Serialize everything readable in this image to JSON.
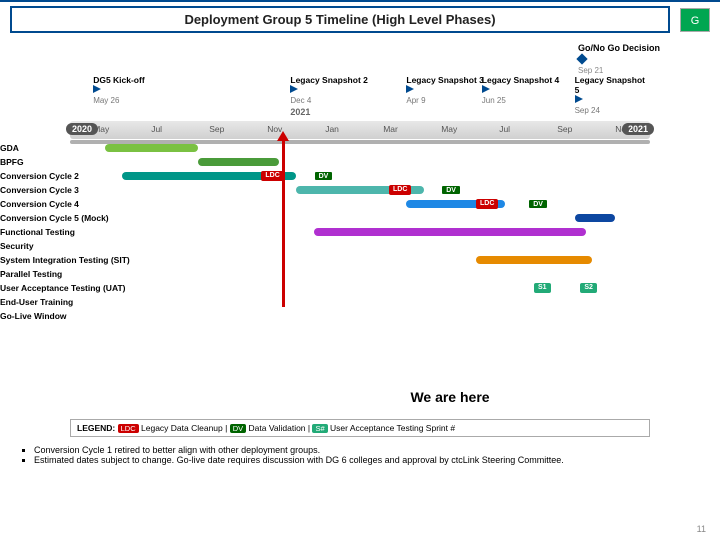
{
  "header": {
    "title": "Deployment Group 5 Timeline (High Level Phases)",
    "status": "G"
  },
  "gonogo": {
    "label": "Go/No Go Decision",
    "date": "Sep 21"
  },
  "milestones": [
    {
      "label": "DG5 Kick-off",
      "date": "May 26",
      "x": 4
    },
    {
      "label": "Legacy Snapshot 2",
      "date": "Dec 4",
      "x": 38
    },
    {
      "label": "Legacy Snapshot 3",
      "date": "Apr 9",
      "x": 58
    },
    {
      "label": "Legacy Snapshot 4",
      "date": "Jun 25",
      "x": 71
    },
    {
      "label": "Legacy Snapshot 5",
      "date": "Sep 24",
      "x": 87
    }
  ],
  "axis": {
    "yearLeft": "2020",
    "yearRight": "2021",
    "midYear": "2021",
    "ticks": [
      {
        "t": "May",
        "x": 4
      },
      {
        "t": "Jul",
        "x": 14
      },
      {
        "t": "Sep",
        "x": 24
      },
      {
        "t": "Nov",
        "x": 34
      },
      {
        "t": "Jan",
        "x": 44
      },
      {
        "t": "Mar",
        "x": 54
      },
      {
        "t": "May",
        "x": 64
      },
      {
        "t": "Jul",
        "x": 74
      },
      {
        "t": "Sep",
        "x": 84
      },
      {
        "t": "Nov",
        "x": 94
      }
    ]
  },
  "rows": [
    {
      "name": "GDA",
      "bars": [
        {
          "x": 6,
          "w": 16,
          "c": "c-green1"
        }
      ]
    },
    {
      "name": "BPFG",
      "bars": [
        {
          "x": 22,
          "w": 14,
          "c": "c-green2"
        }
      ]
    },
    {
      "name": "Conversion Cycle 2",
      "bars": [
        {
          "x": 9,
          "w": 30,
          "c": "c-teal"
        }
      ],
      "markers": [
        {
          "t": "LDC",
          "x": 33,
          "c": "ldc"
        },
        {
          "t": "DV",
          "x": 42,
          "c": "dv"
        }
      ]
    },
    {
      "name": "Conversion Cycle 3",
      "bars": [
        {
          "x": 39,
          "w": 22,
          "c": "c-teal-l"
        }
      ],
      "markers": [
        {
          "t": "LDC",
          "x": 55,
          "c": "ldc"
        },
        {
          "t": "DV",
          "x": 64,
          "c": "dv"
        }
      ]
    },
    {
      "name": "Conversion Cycle 4",
      "bars": [
        {
          "x": 58,
          "w": 17,
          "c": "c-blue3"
        }
      ],
      "markers": [
        {
          "t": "LDC",
          "x": 70,
          "c": "ldc"
        },
        {
          "t": "DV",
          "x": 79,
          "c": "dv"
        }
      ]
    },
    {
      "name": "Conversion Cycle 5 (Mock)",
      "bars": [
        {
          "x": 87,
          "w": 7,
          "c": "c-blue4"
        }
      ]
    },
    {
      "name": "Functional Testing",
      "bars": [
        {
          "x": 42,
          "w": 47,
          "c": "c-purple"
        }
      ]
    },
    {
      "name": "Security",
      "bars": []
    },
    {
      "name": "System Integration Testing (SIT)",
      "bars": [
        {
          "x": 70,
          "w": 20,
          "c": "c-orange"
        }
      ]
    },
    {
      "name": "Parallel Testing",
      "bars": []
    },
    {
      "name": "User Acceptance Testing (UAT)",
      "markers": [
        {
          "t": "S1",
          "x": 80,
          "c": "s-badge"
        },
        {
          "t": "S2",
          "x": 88,
          "c": "s-badge"
        }
      ]
    },
    {
      "name": "End-User Training",
      "bars": []
    },
    {
      "name": "Go-Live Window",
      "bars": []
    }
  ],
  "topbar": {
    "x": 0,
    "w": 100
  },
  "weHere": "We are here",
  "legend": {
    "prefix": "LEGEND:",
    "ldc": "LDC",
    "ldcText": "Legacy Data Cleanup",
    "dv": "DV",
    "dvText": "Data Validation",
    "s": "S#",
    "sText": "User Acceptance Testing Sprint #"
  },
  "notes": [
    "Conversion Cycle 1 retired to better align with other deployment groups.",
    "Estimated dates subject to change. Go-live date requires discussion with DG 6 colleges and approval by ctcLink Steering Committee."
  ],
  "page": "11"
}
